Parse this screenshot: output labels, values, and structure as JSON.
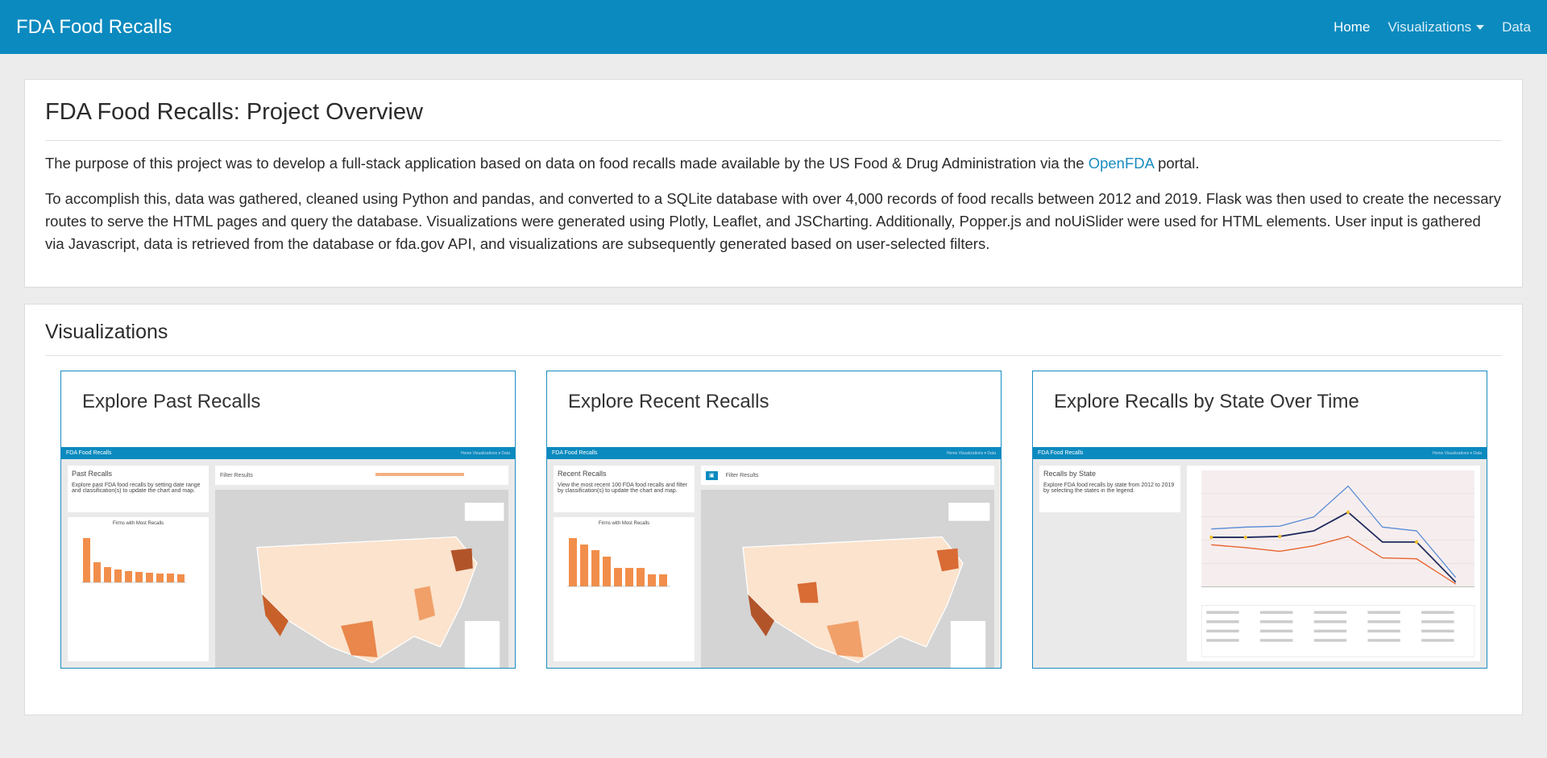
{
  "nav": {
    "brand": "FDA Food Recalls",
    "items": [
      {
        "label": "Home",
        "active": true
      },
      {
        "label": "Visualizations",
        "dropdown": true
      },
      {
        "label": "Data"
      }
    ]
  },
  "overview": {
    "title": "FDA Food Recalls: Project Overview",
    "p1_before": "The purpose of this project was to develop a full-stack application based on data on food recalls made available by the US Food & Drug Administration via the ",
    "p1_link": "OpenFDA",
    "p1_after": " portal.",
    "p2": "To accomplish this, data was gathered, cleaned using Python and pandas, and converted to a SQLite database with over 4,000 records of food recalls between 2012 and 2019. Flask was then used to create the necessary routes to serve the HTML pages and query the database. Visualizations were generated using Plotly, Leaflet, and JSCharting. Additionally, Popper.js and noUiSlider were used for HTML elements. User input is gathered via Javascript, data is retrieved from the database or fda.gov API, and visualizations are subsequently generated based on user-selected filters."
  },
  "visualizations": {
    "title": "Visualizations",
    "cards": [
      {
        "title": "Explore Past Recalls",
        "thumb": {
          "brand": "FDA Food Recalls",
          "nav": "Home  Visualizations ▾  Data",
          "panel": "Past Recalls",
          "desc": "Explore past FDA food recalls by setting date range and classification(s) to update the chart and map.",
          "chart_title": "Firms with Most Recalls",
          "filter": "Filter Results"
        }
      },
      {
        "title": "Explore Recent Recalls",
        "thumb": {
          "brand": "FDA Food Recalls",
          "nav": "Home  Visualizations ▾  Data",
          "panel": "Recent Recalls",
          "desc": "View the most recent 100 FDA food recalls and filter by classification(s) to update the chart and map.",
          "chart_title": "Firms with Most Recalls",
          "filter": "Filter Results"
        }
      },
      {
        "title": "Explore Recalls by State Over Time",
        "thumb": {
          "brand": "FDA Food Recalls",
          "nav": "Home  Visualizations ▾  Data",
          "panel": "Recalls by State",
          "desc": "Explore FDA food recalls by state from 2012 to 2019 by selecting the states in the legend."
        }
      }
    ]
  },
  "colors": {
    "navbar": "#0b8abf",
    "link": "#1a8cc1",
    "card_border": "#1a8cc1",
    "bar": "#f28e4b"
  }
}
